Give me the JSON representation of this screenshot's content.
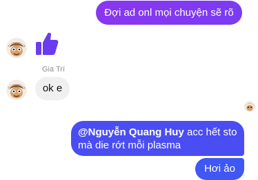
{
  "messages": {
    "m1": {
      "text": "Đợi ad onl mọi chuyện sẽ rõ"
    },
    "sender_name": "Gia Trí",
    "m2": {
      "text": "ok e"
    },
    "m3": {
      "mention": "@Nguyễn Quang Huy",
      "line1_rest": " acc hết sto",
      "line2": "mà die rớt mỗi plasma"
    },
    "m4": {
      "text": "Hơi ảo"
    }
  },
  "icons": {
    "like": "thumbs-up-icon",
    "avatar": "cartoon-avatar"
  },
  "colors": {
    "outgoing_purple": "#8a36f0",
    "outgoing_blue": "#4a4df2",
    "incoming_gray": "#f0f0f0",
    "like_icon": "#6a3cf0"
  }
}
